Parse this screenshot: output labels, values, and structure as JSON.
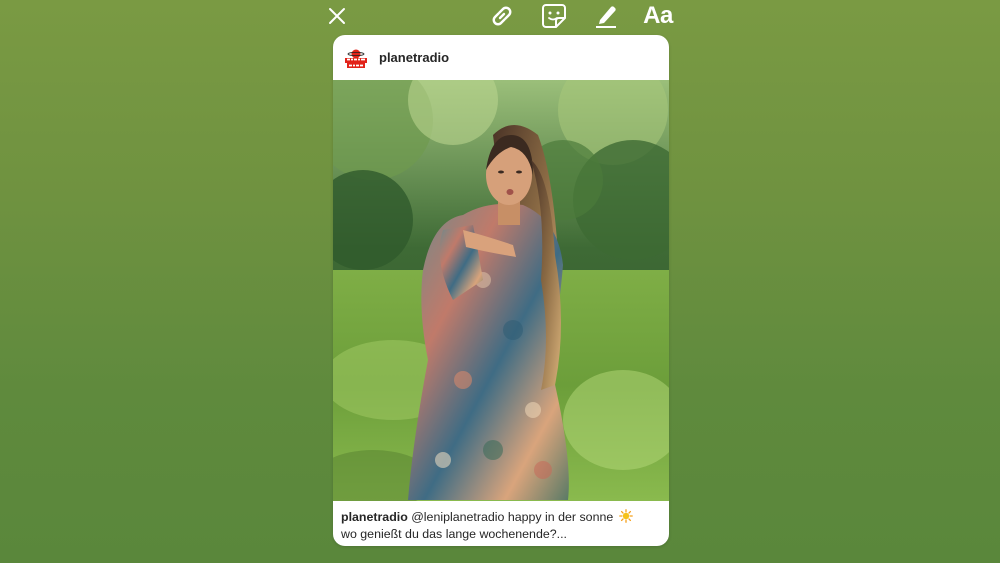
{
  "toolbar": {
    "close_icon": "close-icon",
    "link_icon": "link-icon",
    "sticker_icon": "sticker-icon",
    "draw_icon": "pen-icon",
    "text_label": "Aa"
  },
  "post": {
    "account_name": "planetradio",
    "avatar_text": "planet radio",
    "caption_user": "planetradio",
    "caption_line1": " @leniplanetradio happy in der sonne",
    "caption_emoji": "sun-icon",
    "caption_line2": "wo genießt du das lange wochenende?...",
    "photo_icon": "photo-woman-blowing-kiss"
  },
  "colors": {
    "background_top": "#7a9a43",
    "background_bottom": "#5a873b",
    "card": "#ffffff",
    "text": "#262626",
    "brand_red": "#e2231a"
  }
}
